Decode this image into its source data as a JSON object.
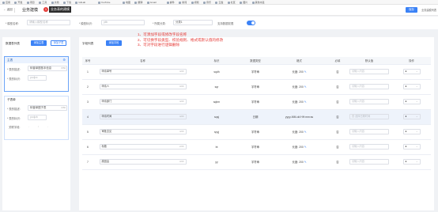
{
  "bookmarks": [
    "应用",
    "开发",
    "项目",
    "工具",
    "文档",
    "下载",
    "GitLab",
    "YouTube",
    "地图",
    "翻译",
    "Gmail",
    "邮件",
    "新闻",
    "视频",
    "音乐",
    "云盘",
    "社区",
    "图片",
    "其他书签"
  ],
  "header": {
    "back_label": "← 返回",
    "title": "业务建模",
    "red_badge": "1",
    "tooltip": "业务表的建模",
    "save_label": "保存",
    "right_link": "业务建模列表"
  },
  "form": {
    "model_name_label": "* 模型名称:",
    "model_name_placeholder": "请输入模型名称",
    "model_code_label": "* 模型标识:",
    "model_code_value": "jdlb",
    "classify_label": "* 所属分类:",
    "classify_value": "分类1",
    "switch_label": "支持数据权限",
    "switch_on": true
  },
  "left": {
    "tab_label": "数据表列表",
    "add_main_label": "添加主表",
    "add_child_label": "添加子表",
    "main_card": {
      "title": "主表",
      "name_label": "* 表的描述:",
      "name_value": "转普单据基本信息",
      "name_count": "8/50",
      "code_label": "* 表的标识:",
      "code_value": "pcdjxx"
    },
    "child_card": {
      "title": "子表单",
      "name_label": "* 表的描述:",
      "name_value": "转普单据子表",
      "name_count": "6/50",
      "code_label": "* 表的标识:",
      "code_value": "pcdjzb",
      "relation_label": "关联字段:",
      "relation_values": [
        "-",
        "/",
        "-"
      ]
    }
  },
  "main": {
    "tab_label": "字段列表",
    "add_field_label": "添加字段",
    "notes": [
      "1、可添加字段或修改字段名称",
      "2、可切换字段类型、校验规则、格式或默认值的修改",
      "3、可对字段进行逻辑删除"
    ],
    "columns": [
      "序号",
      "名称",
      "标识",
      "数据类型",
      "格式",
      "必填",
      "默认值",
      "操作"
    ],
    "rows": [
      {
        "no": "1",
        "name": "申请单号",
        "count": "4/20",
        "code": "sqdh",
        "type": "字符串",
        "format": "长度: 200",
        "required": "否",
        "default": "请输入内容",
        "is_date": false
      },
      {
        "no": "2",
        "name": "申请人",
        "count": "3/20",
        "code": "sqr",
        "type": "字符串",
        "format": "长度: 200",
        "required": "否",
        "default": "请输入内容",
        "is_date": false
      },
      {
        "no": "3",
        "name": "申请部门",
        "count": "4/20",
        "code": "sqbm",
        "type": "字符串",
        "format": "长度: 200",
        "required": "否",
        "default": "请输入内容",
        "is_date": false
      },
      {
        "no": "4",
        "name": "申请时间",
        "count": "4/20",
        "code": "sqsj",
        "type": "日期",
        "format": "yyyy-MM-dd HH:mm:ss",
        "required": "否",
        "default": "选择日期时间",
        "is_date": true
      },
      {
        "no": "5",
        "name": "审批意见",
        "count": "4/20",
        "code": "spyj",
        "type": "字符串",
        "format": "长度: 200",
        "required": "否",
        "default": "请输入内容",
        "is_date": false
      },
      {
        "no": "6",
        "name": "标题",
        "count": "2/20",
        "code": "bt",
        "type": "字符串",
        "format": "长度: 200",
        "required": "否",
        "default": "请输入内容",
        "is_date": false
      },
      {
        "no": "7",
        "name": "原因由",
        "count": "3/20",
        "code": "yy",
        "type": "字符串",
        "format": "长度: 200",
        "required": "否",
        "default": "请输入内容",
        "is_date": false
      }
    ]
  }
}
